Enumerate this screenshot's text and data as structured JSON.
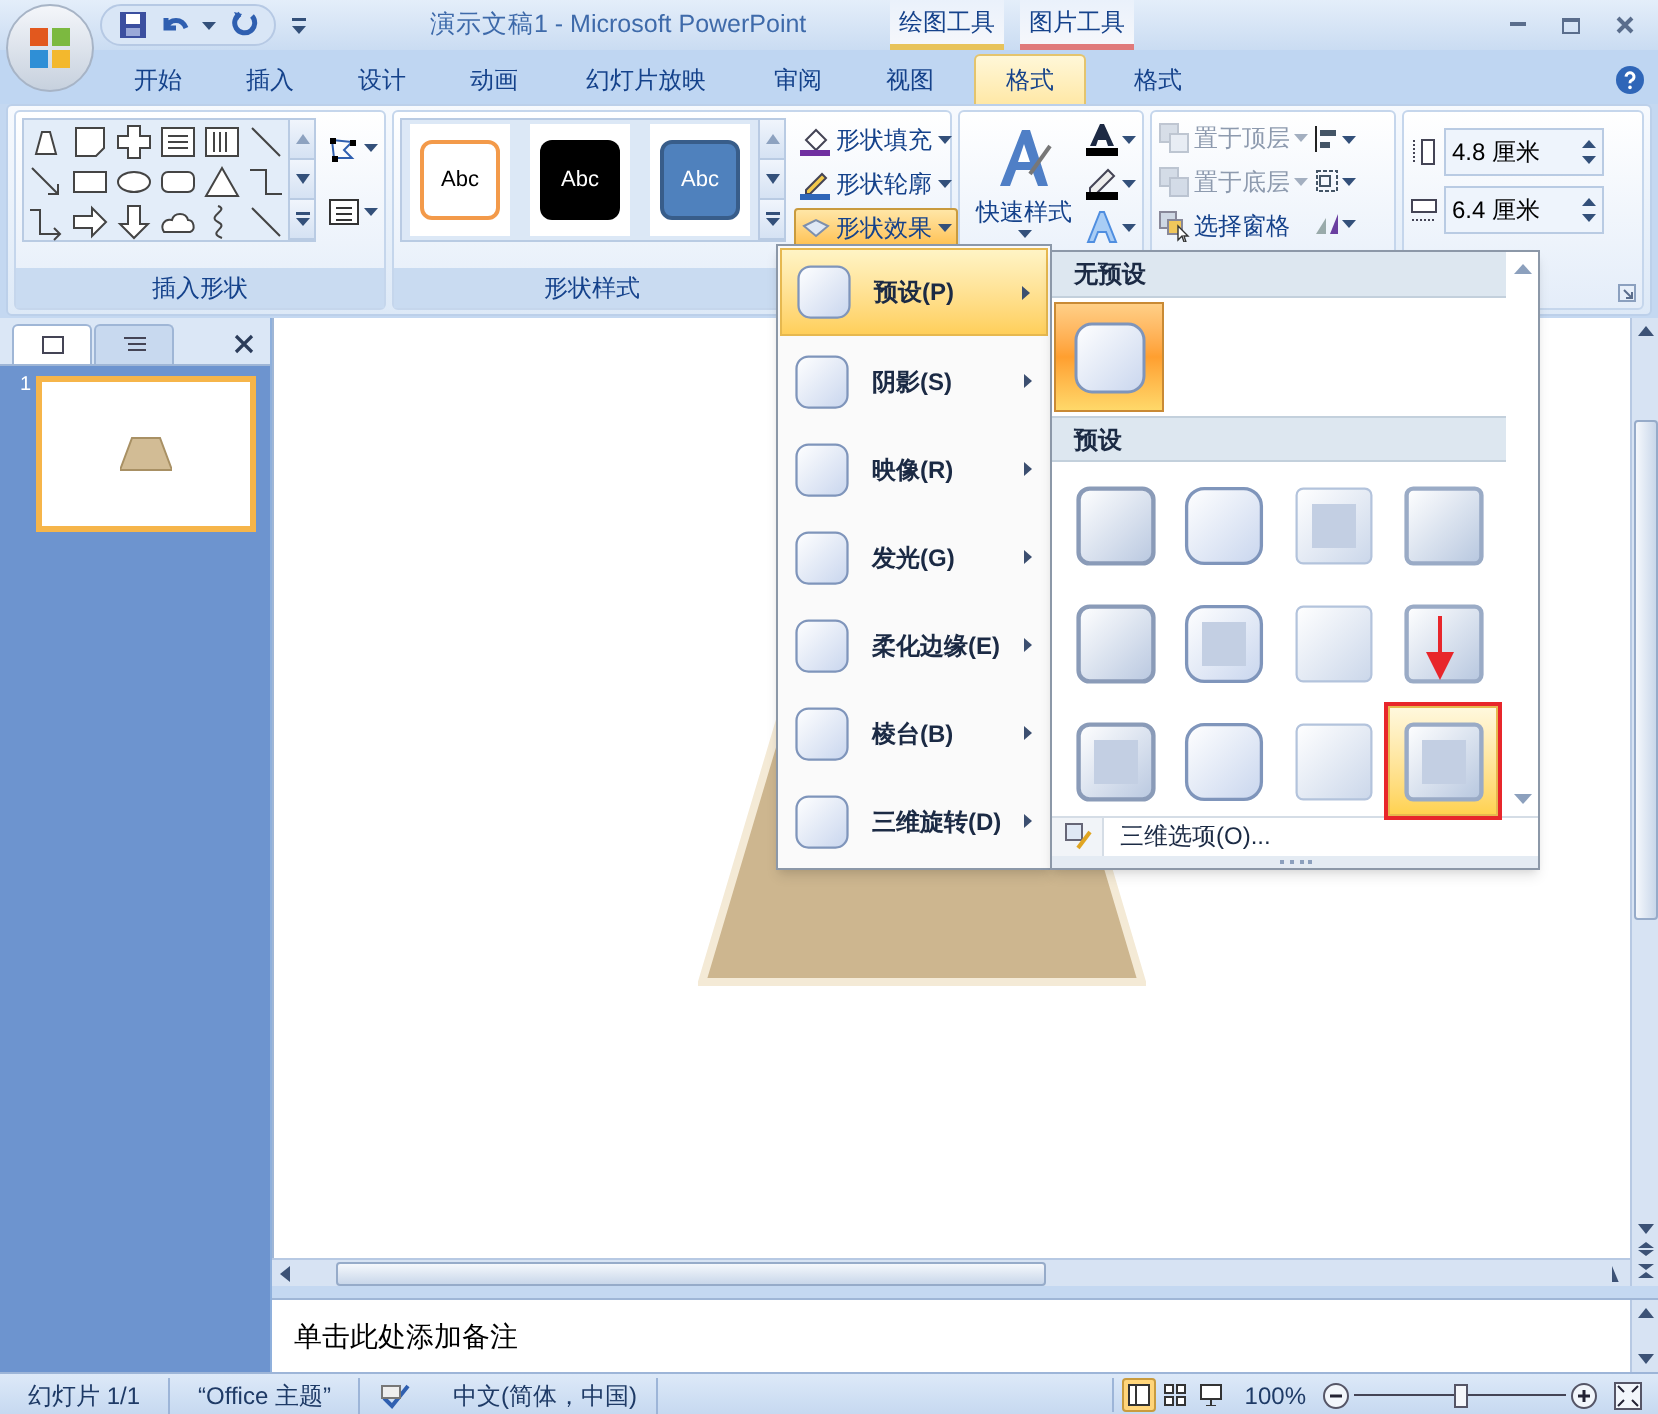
{
  "window": {
    "title": "演示文稿1 - Microsoft PowerPoint",
    "contextual_groups": [
      {
        "label": "绘图工具",
        "color": "#e8c35a"
      },
      {
        "label": "图片工具",
        "color": "#e07a7a"
      }
    ]
  },
  "tabs": [
    {
      "label": "开始",
      "selected": false
    },
    {
      "label": "插入",
      "selected": false
    },
    {
      "label": "设计",
      "selected": false
    },
    {
      "label": "动画",
      "selected": false
    },
    {
      "label": "幻灯片放映",
      "selected": false
    },
    {
      "label": "审阅",
      "selected": false
    },
    {
      "label": "视图",
      "selected": false
    },
    {
      "label": "格式",
      "selected": true
    },
    {
      "label": "格式",
      "selected": false
    }
  ],
  "ribbon": {
    "insert_shapes": {
      "label": "插入形状"
    },
    "shape_styles": {
      "label": "形状样式",
      "styles": [
        {
          "label": "Abc",
          "kind": "outline"
        },
        {
          "label": "Abc",
          "kind": "dark"
        },
        {
          "label": "Abc",
          "kind": "filled"
        }
      ],
      "commands": [
        {
          "label": "形状填充",
          "kind": "fill",
          "selected": false
        },
        {
          "label": "形状轮廓",
          "kind": "outline",
          "selected": false
        },
        {
          "label": "形状效果",
          "kind": "effects",
          "selected": true
        }
      ]
    },
    "wordart": {
      "label": "快速样式"
    },
    "arrange": [
      {
        "label": "置于顶层",
        "kind": "front",
        "disabled": true
      },
      {
        "label": "置于底层",
        "kind": "back",
        "disabled": true
      },
      {
        "label": "选择窗格",
        "kind": "pane",
        "disabled": false
      }
    ],
    "size": {
      "height": "4.8 厘米",
      "width": "6.4 厘米"
    }
  },
  "effects_menu": [
    {
      "label": "预设(P)",
      "selected": true
    },
    {
      "label": "阴影(S)",
      "selected": false
    },
    {
      "label": "映像(R)",
      "selected": false
    },
    {
      "label": "发光(G)",
      "selected": false
    },
    {
      "label": "柔化边缘(E)",
      "selected": false
    },
    {
      "label": "棱台(B)",
      "selected": false
    },
    {
      "label": "三维旋转(D)",
      "selected": false
    }
  ],
  "presets_gallery": {
    "none_heading": "无预设",
    "none_selected": true,
    "preset_heading": "预设",
    "presets": [
      {
        "selected": false,
        "marked": false
      },
      {
        "selected": false,
        "marked": false
      },
      {
        "selected": false,
        "marked": false
      },
      {
        "selected": false,
        "marked": false
      },
      {
        "selected": false,
        "marked": false
      },
      {
        "selected": false,
        "marked": false
      },
      {
        "selected": false,
        "marked": false
      },
      {
        "selected": false,
        "marked": false
      },
      {
        "selected": false,
        "marked": false
      },
      {
        "selected": false,
        "marked": false
      },
      {
        "selected": false,
        "marked": false
      },
      {
        "selected": true,
        "marked": true
      }
    ],
    "options": "三维选项(O)..."
  },
  "slides_pane": {
    "tabs": [
      {
        "selected": true
      },
      {
        "selected": false
      }
    ],
    "thumbnails": [
      {
        "number": "1",
        "selected": true
      }
    ]
  },
  "notes": {
    "text": "单击此处添加备注"
  },
  "status_bar": {
    "slide": "幻灯片 1/1",
    "theme": "“Office 主题”",
    "language": "中文(简体，中国)",
    "views": [
      {
        "selected": true
      },
      {
        "selected": false
      },
      {
        "selected": false
      }
    ],
    "zoom": "100%",
    "level": 0.5
  }
}
